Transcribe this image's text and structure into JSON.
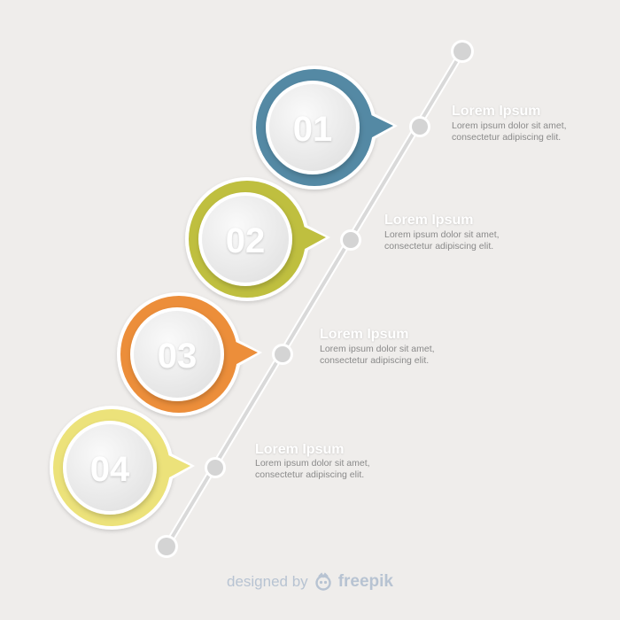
{
  "steps": [
    {
      "number": "01",
      "color": "#5489a4",
      "heading": "Lorem Ipsum",
      "desc": "Lorem ipsum dolor sit amet, consectetur adipiscing elit."
    },
    {
      "number": "02",
      "color": "#bfbf3f",
      "heading": "Lorem Ipsum",
      "desc": "Lorem ipsum dolor sit amet, consectetur adipiscing elit."
    },
    {
      "number": "03",
      "color": "#ec8e3a",
      "heading": "Lorem Ipsum",
      "desc": "Lorem ipsum dolor sit amet, consectetur adipiscing elit."
    },
    {
      "number": "04",
      "color": "#ece27a",
      "heading": "Lorem Ipsum",
      "desc": "Lorem ipsum dolor sit amet, consectetur adipiscing elit."
    }
  ],
  "footer": {
    "designed_by": "designed by",
    "brand": "freepik",
    "brand_icon": "freepik-logo-icon"
  }
}
